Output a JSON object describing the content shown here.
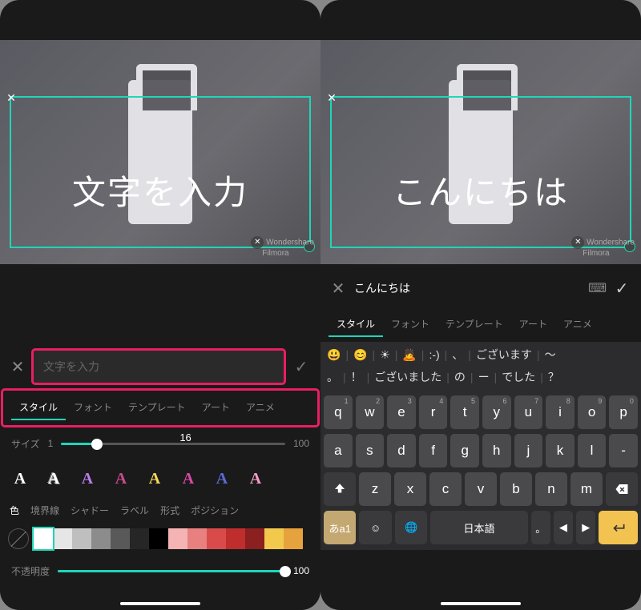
{
  "left": {
    "overlay_text": "文字を入力",
    "watermark": {
      "line1": "Wondershare",
      "line2": "Filmora"
    },
    "input_placeholder": "文字を入力",
    "tabs": [
      "スタイル",
      "フォント",
      "テンプレート",
      "アート",
      "アニメ"
    ],
    "active_tab": 0,
    "size": {
      "label": "サイズ",
      "min": 1,
      "max": 100,
      "value": 16
    },
    "style_letters": [
      {
        "glyph": "A",
        "color": "#ffffff"
      },
      {
        "glyph": "A",
        "color": "#ffffff",
        "stroke": "#888"
      },
      {
        "glyph": "A",
        "color": "#b97de8"
      },
      {
        "glyph": "A",
        "color": "#c94b8c"
      },
      {
        "glyph": "A",
        "color": "#f6d95b"
      },
      {
        "glyph": "A",
        "color": "#d94aa6"
      },
      {
        "glyph": "A",
        "color": "#5a6bd6"
      },
      {
        "glyph": "A",
        "color": "#f49cc6"
      }
    ],
    "subtabs": [
      "色",
      "境界線",
      "シャドー",
      "ラベル",
      "形式",
      "ポジション"
    ],
    "active_subtab": 0,
    "colors": [
      "#ffffff",
      "#e6e6e6",
      "#bfbfbf",
      "#8c8c8c",
      "#595959",
      "#262626",
      "#000000",
      "#f5b3b3",
      "#e88080",
      "#d94a4a",
      "#bf2d2d",
      "#8c1f1f",
      "#f2c94c",
      "#e6a23c"
    ],
    "opacity": {
      "label": "不透明度",
      "value": 100
    }
  },
  "right": {
    "overlay_text": "こんにちは",
    "watermark": {
      "line1": "Wondershare",
      "line2": "Filmora"
    },
    "input_value": "こんにちは",
    "tabs": [
      "スタイル",
      "フォント",
      "テンプレート",
      "アート",
      "アニメ"
    ],
    "active_tab": 0,
    "suggest1": [
      "😃",
      "😊",
      "☀",
      "🙇",
      ":-)",
      "、",
      "ございます",
      "〜"
    ],
    "suggest2": [
      "。",
      "！",
      "ございました",
      "の",
      "ー",
      "でした",
      "？"
    ],
    "keyboard": {
      "row1": [
        {
          "k": "q",
          "n": "1"
        },
        {
          "k": "w",
          "n": "2"
        },
        {
          "k": "e",
          "n": "3"
        },
        {
          "k": "r",
          "n": "4"
        },
        {
          "k": "t",
          "n": "5"
        },
        {
          "k": "y",
          "n": "6"
        },
        {
          "k": "u",
          "n": "7"
        },
        {
          "k": "i",
          "n": "8"
        },
        {
          "k": "o",
          "n": "9"
        },
        {
          "k": "p",
          "n": "0"
        }
      ],
      "row2": [
        {
          "k": "a"
        },
        {
          "k": "s"
        },
        {
          "k": "d"
        },
        {
          "k": "f"
        },
        {
          "k": "g"
        },
        {
          "k": "h"
        },
        {
          "k": "j"
        },
        {
          "k": "k"
        },
        {
          "k": "l"
        },
        {
          "k": "-"
        }
      ],
      "row3": [
        {
          "k": "z"
        },
        {
          "k": "x"
        },
        {
          "k": "c"
        },
        {
          "k": "v"
        },
        {
          "k": "b"
        },
        {
          "k": "n"
        },
        {
          "k": "m"
        }
      ],
      "lang_key": "あa1",
      "space": "日本語"
    }
  }
}
